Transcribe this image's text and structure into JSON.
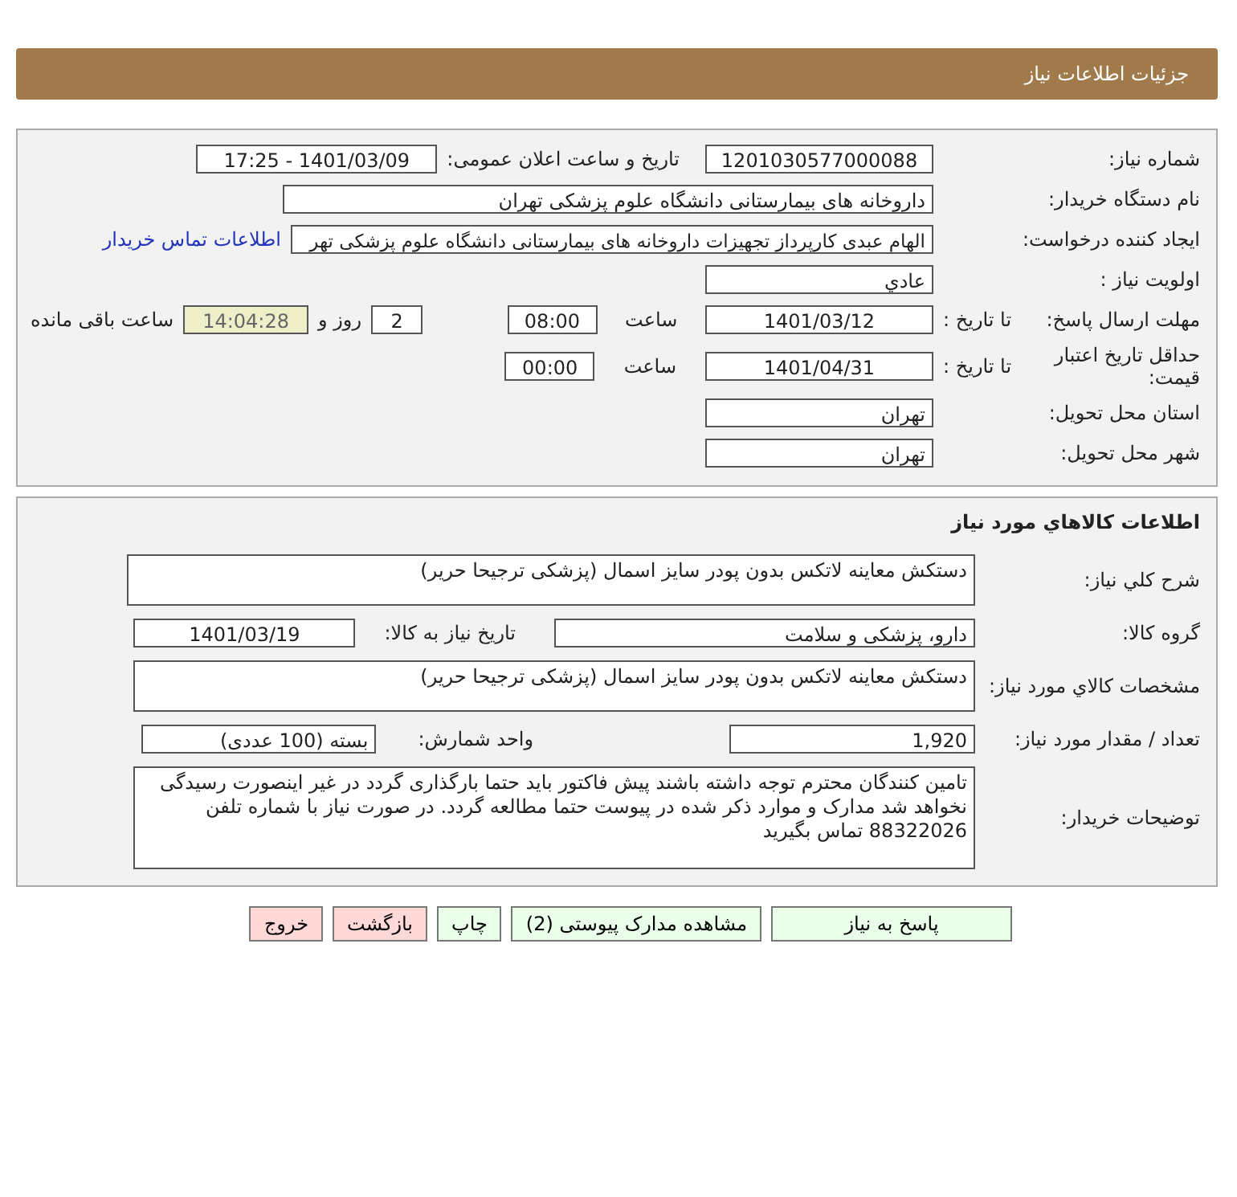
{
  "header": {
    "title": "جزئیات اطلاعات نیاز"
  },
  "request": {
    "need_number": {
      "label": "شماره نیاز:",
      "value": "1201030577000088"
    },
    "announce_date": {
      "label": "تاریخ و ساعت اعلان عمومی:",
      "value": "1401/03/09 - 17:25"
    },
    "buyer_org": {
      "label": "نام دستگاه خریدار:",
      "value": "داروخانه های بیمارستانی دانشگاه علوم پزشکی تهران"
    },
    "creator": {
      "label": "ایجاد کننده درخواست:",
      "value": "الهام عبدی کارپرداز تجهیزات داروخانه های بیمارستانی دانشگاه علوم پزشکی تهر",
      "link": "اطلاعات تماس خریدار"
    },
    "priority": {
      "label": "اولویت نیاز :",
      "value": "عادي"
    },
    "deadline": {
      "label": "مهلت ارسال پاسخ:",
      "to_label": "تا تاریخ :",
      "date": "1401/03/12",
      "time_label": "ساعت",
      "time": "08:00",
      "days": "2",
      "days_label": "روز و",
      "remaining": "14:04:28",
      "remaining_label": "ساعت باقی مانده"
    },
    "validity": {
      "label": "حداقل تاریخ اعتبار قیمت:",
      "to_label": "تا تاریخ :",
      "date": "1401/04/31",
      "time_label": "ساعت",
      "time": "00:00"
    },
    "province": {
      "label": "استان محل تحویل:",
      "value": "تهران"
    },
    "city": {
      "label": "شهر محل تحویل:",
      "value": "تهران"
    }
  },
  "goods": {
    "title": "اطلاعات کالاهاي مورد نیاز",
    "summary": {
      "label": "شرح کلي نیاز:",
      "value": "دستکش معاینه لاتکس بدون پودر سایز اسمال (پزشکی ترجیحا حریر)"
    },
    "group": {
      "label": "گروه کالا:",
      "value": "دارو، پزشکی و سلامت",
      "date_label": "تاریخ نیاز به کالا:",
      "date": "1401/03/19"
    },
    "spec": {
      "label": "مشخصات کالاي مورد نیاز:",
      "value": "دستکش معاینه لاتکس بدون پودر سایز اسمال (پزشکی ترجیحا حریر)"
    },
    "quantity": {
      "label": "تعداد / مقدار مورد نیاز:",
      "value": "1,920",
      "unit_label": "واحد شمارش:",
      "unit": "بسته (100 عددی)"
    },
    "notes": {
      "label": "توضیحات خریدار:",
      "value": "تامین کنندگان محترم توجه داشته باشند پیش فاکتور باید حتما بارگذاری گردد در غیر اینصورت رسیدگی نخواهد شد مدارک و موارد ذکر شده در پیوست حتما مطالعه گردد. در صورت نیاز با شماره تلفن 88322026 تماس بگیرید"
    }
  },
  "buttons": [
    {
      "label": "پاسخ به نیاز",
      "kind": "normal"
    },
    {
      "label": "مشاهده مدارک پیوستی (2)",
      "kind": "normal"
    },
    {
      "label": "چاپ",
      "kind": "normal"
    },
    {
      "label": "بازگشت",
      "kind": "danger"
    },
    {
      "label": "خروج",
      "kind": "danger"
    }
  ]
}
